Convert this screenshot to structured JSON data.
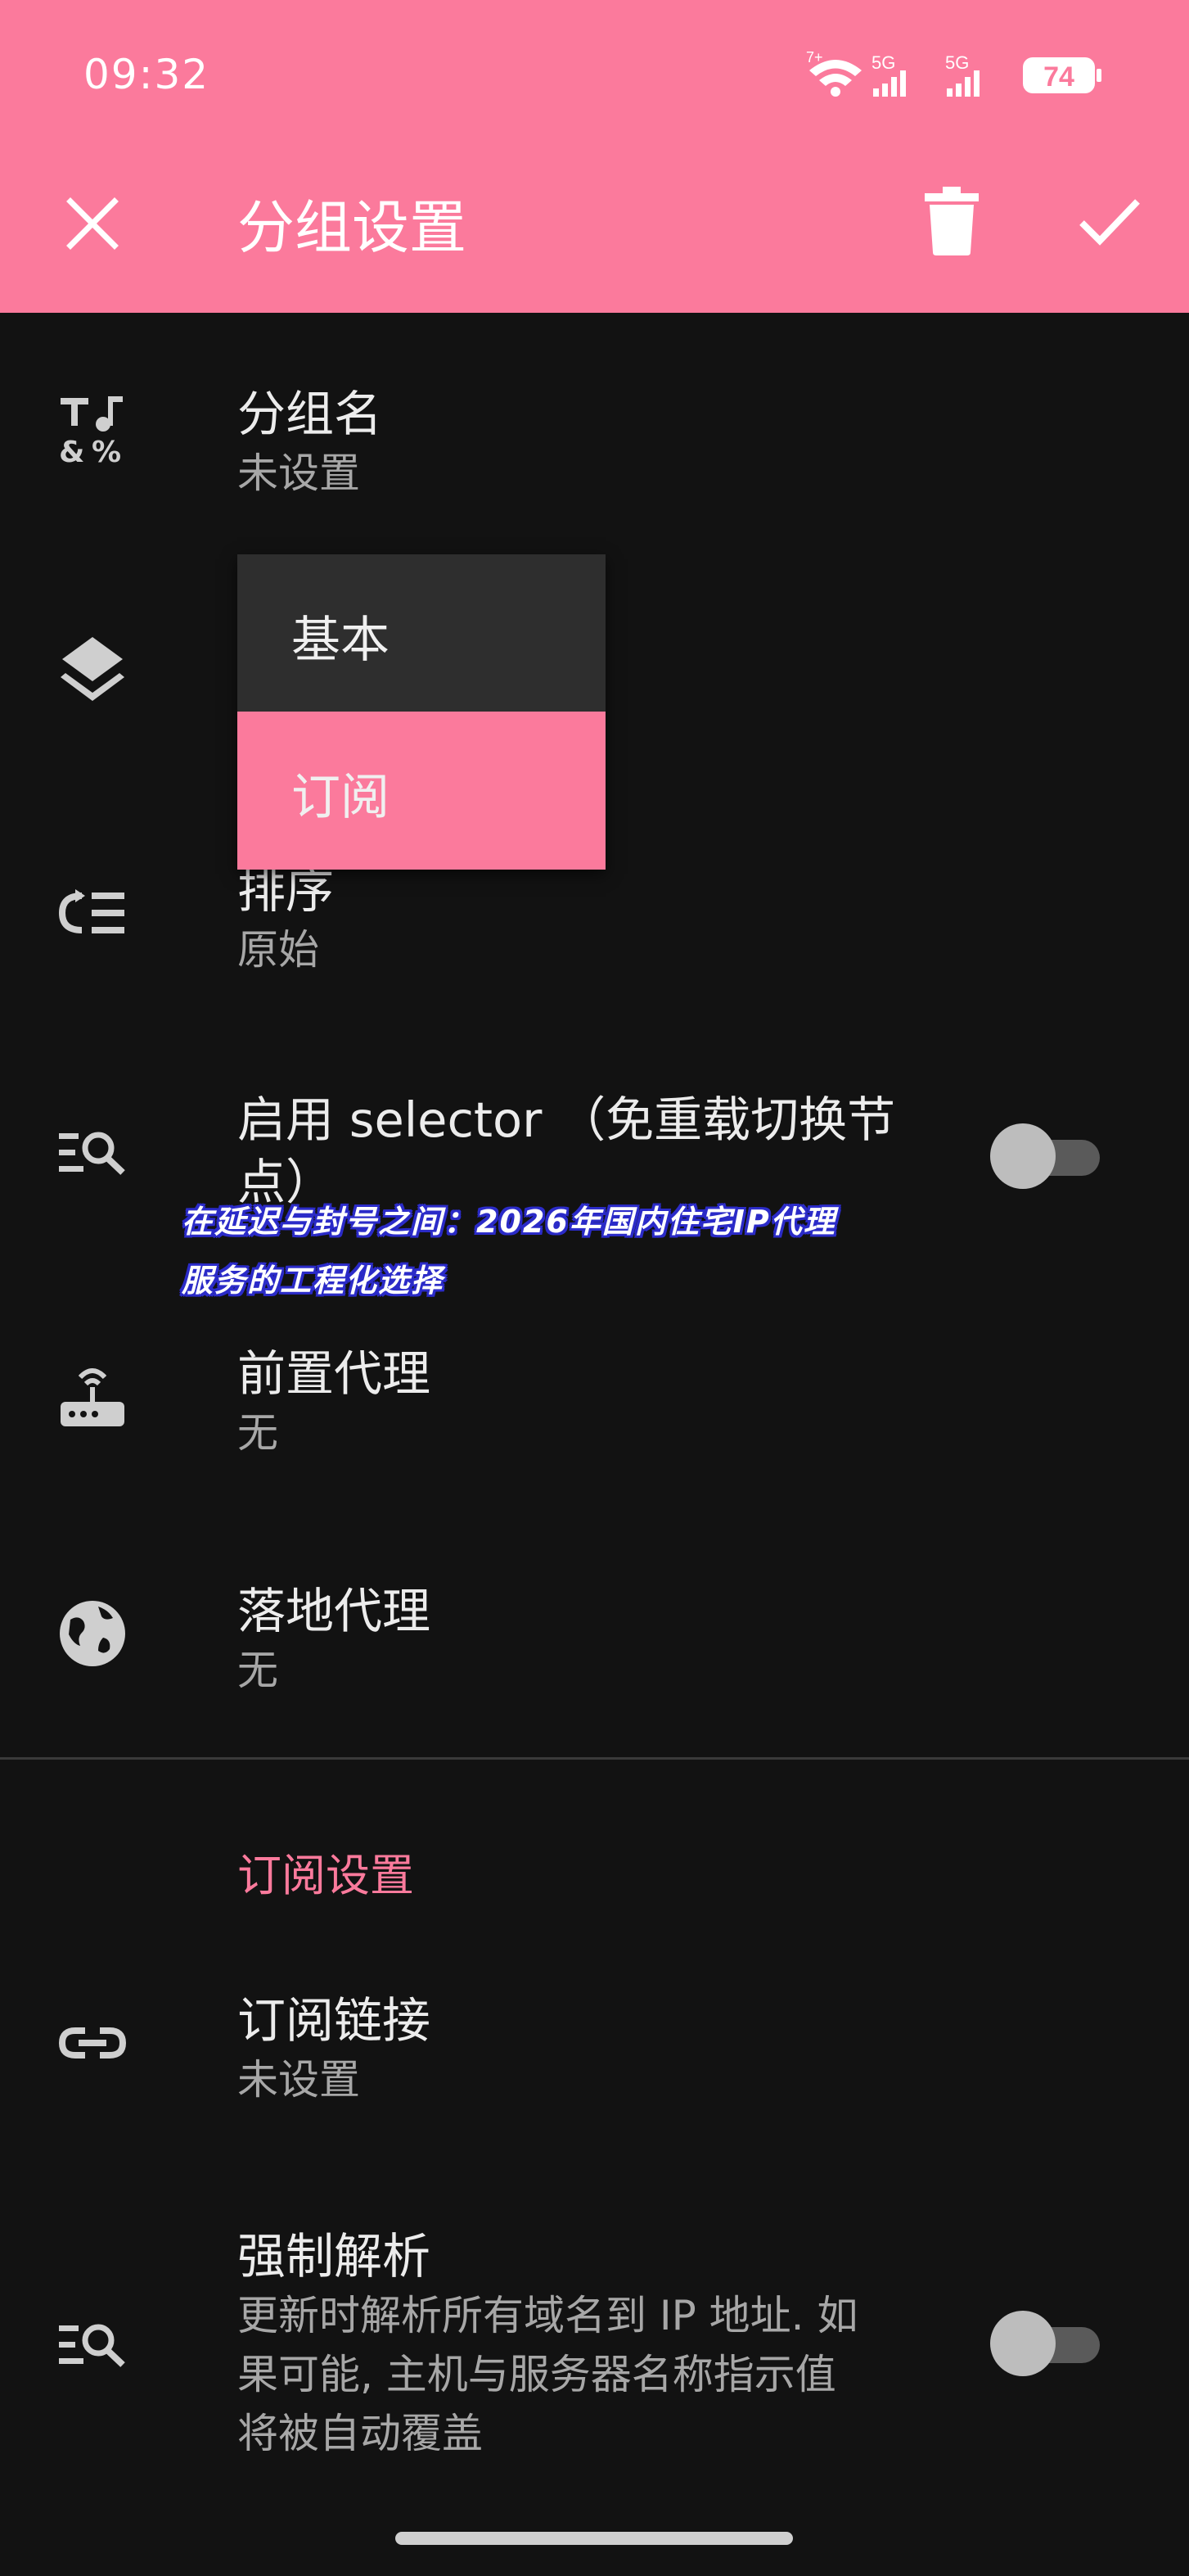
{
  "status_bar": {
    "time": "09:32",
    "battery": "74",
    "network1": "5G",
    "network2": "5G",
    "wifi_label": "7+"
  },
  "toolbar": {
    "title": "分组设置",
    "close_icon": "close-icon",
    "delete_icon": "trash-icon",
    "confirm_icon": "check-icon"
  },
  "rows": {
    "group_name": {
      "title": "分组名",
      "subtitle": "未设置"
    },
    "sort": {
      "title": "排序",
      "subtitle": "原始"
    },
    "selector": {
      "title": "启用 selector （免重载切换节点）"
    },
    "front_proxy": {
      "title": "前置代理",
      "subtitle": "无"
    },
    "landing_proxy": {
      "title": "落地代理",
      "subtitle": "无"
    }
  },
  "dropdown": {
    "options": [
      "基本",
      "订阅"
    ],
    "selected": "订阅"
  },
  "subscription_section": {
    "title": "订阅设置",
    "link": {
      "title": "订阅链接",
      "subtitle": "未设置"
    },
    "force_resolve": {
      "title": "强制解析",
      "subtitle_lines": [
        "更新时解析所有域名到 IP 地址. 如",
        "果可能, 主机与服务器名称指示值",
        "将被自动覆盖"
      ]
    }
  },
  "overlay_banner": {
    "lines": [
      "在延迟与封号之间：2026年国内住宅IP代理",
      "服务的工程化选择"
    ]
  },
  "colors": {
    "accent": "#fb7a9c",
    "background": "#121212",
    "dropdown_bg": "#2e2e2e",
    "switch_off": "#bdbdbd"
  }
}
